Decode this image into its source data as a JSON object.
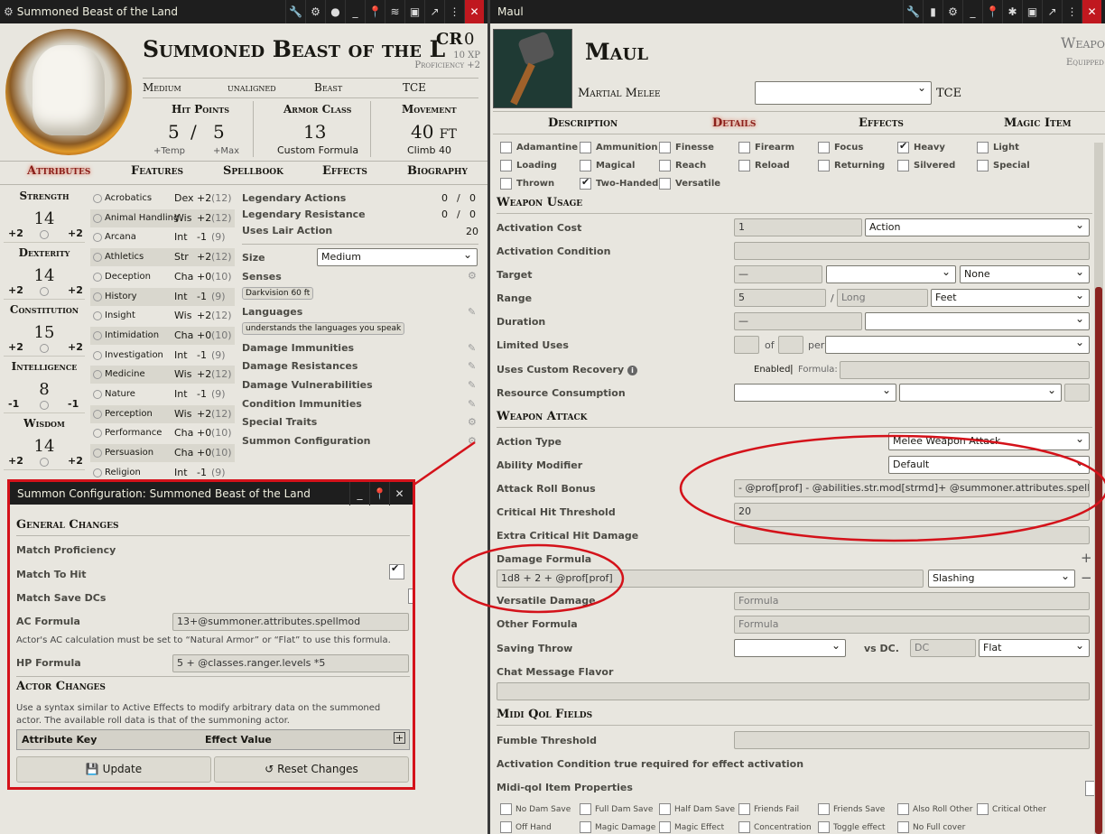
{
  "actor_window": {
    "title": "Summoned Beast of the Land",
    "name": "Summoned Beast of the L",
    "cr_label": "CR",
    "cr_value": "0",
    "xp": "10 XP",
    "proficiency": "Proficiency +2",
    "size": "Medium",
    "alignment": "unaligned",
    "type": "Beast",
    "source": "TCE",
    "hp_label": "Hit Points",
    "hp_value": "5",
    "hp_slash": "/",
    "hp_max": "5",
    "hp_temp_label": "+Temp",
    "hp_max_label": "+Max",
    "ac_label": "Armor Class",
    "ac_value": "13",
    "ac_formula": "Custom Formula",
    "move_label": "Movement",
    "move_value": "40 ft",
    "move_climb": "Climb 40",
    "tabs": [
      "Attributes",
      "Features",
      "Spellbook",
      "Effects",
      "Biography"
    ],
    "abilities": [
      {
        "name": "Strength",
        "score": "14",
        "mod": "+2",
        "save": "+2"
      },
      {
        "name": "Dexterity",
        "score": "14",
        "mod": "+2",
        "save": "+2"
      },
      {
        "name": "Constitution",
        "score": "15",
        "mod": "+2",
        "save": "+2"
      },
      {
        "name": "Intelligence",
        "score": "8",
        "mod": "-1",
        "save": "-1"
      },
      {
        "name": "Wisdom",
        "score": "14",
        "mod": "+2",
        "save": "+2"
      }
    ],
    "skills": [
      {
        "name": "Acrobatics",
        "abl": "Dex",
        "mod": "+2",
        "pass": "(12)"
      },
      {
        "name": "Animal Handling",
        "abl": "Wis",
        "mod": "+2",
        "pass": "(12)"
      },
      {
        "name": "Arcana",
        "abl": "Int",
        "mod": "-1",
        "pass": "(9)"
      },
      {
        "name": "Athletics",
        "abl": "Str",
        "mod": "+2",
        "pass": "(12)"
      },
      {
        "name": "Deception",
        "abl": "Cha",
        "mod": "+0",
        "pass": "(10)"
      },
      {
        "name": "History",
        "abl": "Int",
        "mod": "-1",
        "pass": "(9)"
      },
      {
        "name": "Insight",
        "abl": "Wis",
        "mod": "+2",
        "pass": "(12)"
      },
      {
        "name": "Intimidation",
        "abl": "Cha",
        "mod": "+0",
        "pass": "(10)"
      },
      {
        "name": "Investigation",
        "abl": "Int",
        "mod": "-1",
        "pass": "(9)"
      },
      {
        "name": "Medicine",
        "abl": "Wis",
        "mod": "+2",
        "pass": "(12)"
      },
      {
        "name": "Nature",
        "abl": "Int",
        "mod": "-1",
        "pass": "(9)"
      },
      {
        "name": "Perception",
        "abl": "Wis",
        "mod": "+2",
        "pass": "(12)"
      },
      {
        "name": "Performance",
        "abl": "Cha",
        "mod": "+0",
        "pass": "(10)"
      },
      {
        "name": "Persuasion",
        "abl": "Cha",
        "mod": "+0",
        "pass": "(10)"
      },
      {
        "name": "Religion",
        "abl": "Int",
        "mod": "-1",
        "pass": "(9)"
      }
    ],
    "legendary_actions": "Legendary Actions",
    "legendary_resistance": "Legendary Resistance",
    "lair_action": "Uses Lair Action",
    "leg_act_val": "0",
    "leg_act_max": "0",
    "leg_res_val": "0",
    "leg_res_max": "0",
    "lair_init": "20",
    "size_label": "Size",
    "size_select": "Medium",
    "senses_label": "Senses",
    "senses_tag": "Darkvision 60 ft",
    "languages_label": "Languages",
    "languages_tag": "understands the languages you speak",
    "traits": [
      "Damage Immunities",
      "Damage Resistances",
      "Damage Vulnerabilities",
      "Condition Immunities",
      "Special Traits",
      "Summon Configuration"
    ]
  },
  "summon_dialog": {
    "title": "Summon Configuration: Summoned Beast of the Land",
    "general_header": "General Changes",
    "match_proficiency": "Match Proficiency",
    "match_to_hit": "Match To Hit",
    "match_save_dcs": "Match Save DCs",
    "ac_formula_label": "AC Formula",
    "ac_formula_value": "13+@summoner.attributes.spellmod",
    "ac_hint": "Actor's AC calculation must be set to “Natural Armor” or “Flat” to use this formula.",
    "hp_formula_label": "HP Formula",
    "hp_formula_value": "5 + @classes.ranger.levels *5",
    "actor_header": "Actor Changes",
    "actor_hint": "Use a syntax similar to Active Effects to modify arbitrary data on the summoned actor. The available roll data is that of the summoning actor.",
    "col_attr": "Attribute Key",
    "col_value": "Effect Value",
    "update_label": "Update",
    "reset_label": "Reset Changes"
  },
  "item_window": {
    "title": "Maul",
    "name": "Maul",
    "type_right": "Weapon",
    "equipped": "Equipped",
    "subtype": "Martial Melee",
    "source": "TCE",
    "tabs": [
      "Description",
      "Details",
      "Effects",
      "Magic Item"
    ],
    "properties": [
      {
        "label": "Adamantine",
        "on": false
      },
      {
        "label": "Ammunition",
        "on": false
      },
      {
        "label": "Finesse",
        "on": false
      },
      {
        "label": "Firearm",
        "on": false
      },
      {
        "label": "Focus",
        "on": false
      },
      {
        "label": "Heavy",
        "on": true
      },
      {
        "label": "Light",
        "on": false
      },
      {
        "label": "Loading",
        "on": false
      },
      {
        "label": "Magical",
        "on": false
      },
      {
        "label": "Reach",
        "on": false
      },
      {
        "label": "Reload",
        "on": false
      },
      {
        "label": "Returning",
        "on": false
      },
      {
        "label": "Silvered",
        "on": false
      },
      {
        "label": "Special",
        "on": false
      },
      {
        "label": "Thrown",
        "on": false
      },
      {
        "label": "Two-Handed",
        "on": true
      },
      {
        "label": "Versatile",
        "on": false
      }
    ],
    "weapon_usage": "Weapon Usage",
    "activation_cost": "Activation Cost",
    "activation_cost_val": "1",
    "activation_cost_type": "Action",
    "activation_condition": "Activation Condition",
    "target": "Target",
    "target_val": "—",
    "target_none": "None",
    "range": "Range",
    "range_val": "5",
    "range_slash": "/",
    "range_long": "Long",
    "range_unit": "Feet",
    "duration": "Duration",
    "duration_val": "—",
    "limited_uses": "Limited Uses",
    "of": "of",
    "per": "per",
    "custom_recovery": "Uses Custom Recovery",
    "enabled": "Enabled",
    "formula_lbl": "Formula:",
    "resource": "Resource Consumption",
    "weapon_attack": "Weapon Attack",
    "action_type": "Action Type",
    "action_type_val": "Melee Weapon Attack",
    "ability_mod": "Ability Modifier",
    "ability_mod_val": "Default",
    "attack_bonus": "Attack Roll Bonus",
    "attack_bonus_val": "- @prof[prof] - @abilities.str.mod[strmd]+ @summoner.attributes.spellmod",
    "crit_threshold": "Critical Hit Threshold",
    "crit_threshold_val": "20",
    "extra_crit": "Extra Critical Hit Damage",
    "damage_formula": "Damage Formula",
    "damage_val": "1d8 + 2 + @prof[prof]",
    "damage_type": "Slashing",
    "versatile": "Versatile Damage",
    "versatile_ph": "Formula",
    "other_formula": "Other Formula",
    "other_ph": "Formula",
    "saving_throw": "Saving Throw",
    "vs_dc": "vs DC.",
    "dc_ph": "DC",
    "flat": "Flat",
    "chat_flavor": "Chat Message Flavor",
    "midi_header": "Midi Qol Fields",
    "fumble": "Fumble Threshold",
    "activation_true": "Activation Condition true required for effect activation",
    "midi_props": "Midi-qol Item Properties",
    "midi_checks": [
      "No Dam Save",
      "Full Dam Save",
      "Half Dam Save",
      "Friends Fail",
      "Friends Save",
      "Also Roll Other",
      "Critical Other",
      "Off Hand",
      "Magic Damage",
      "Magic Effect",
      "Concentration",
      "Toggle effect",
      "No Full cover"
    ]
  },
  "colors": {
    "accent": "#c0181f",
    "annotation": "#d4121a",
    "parchment": "#e8e6df"
  }
}
